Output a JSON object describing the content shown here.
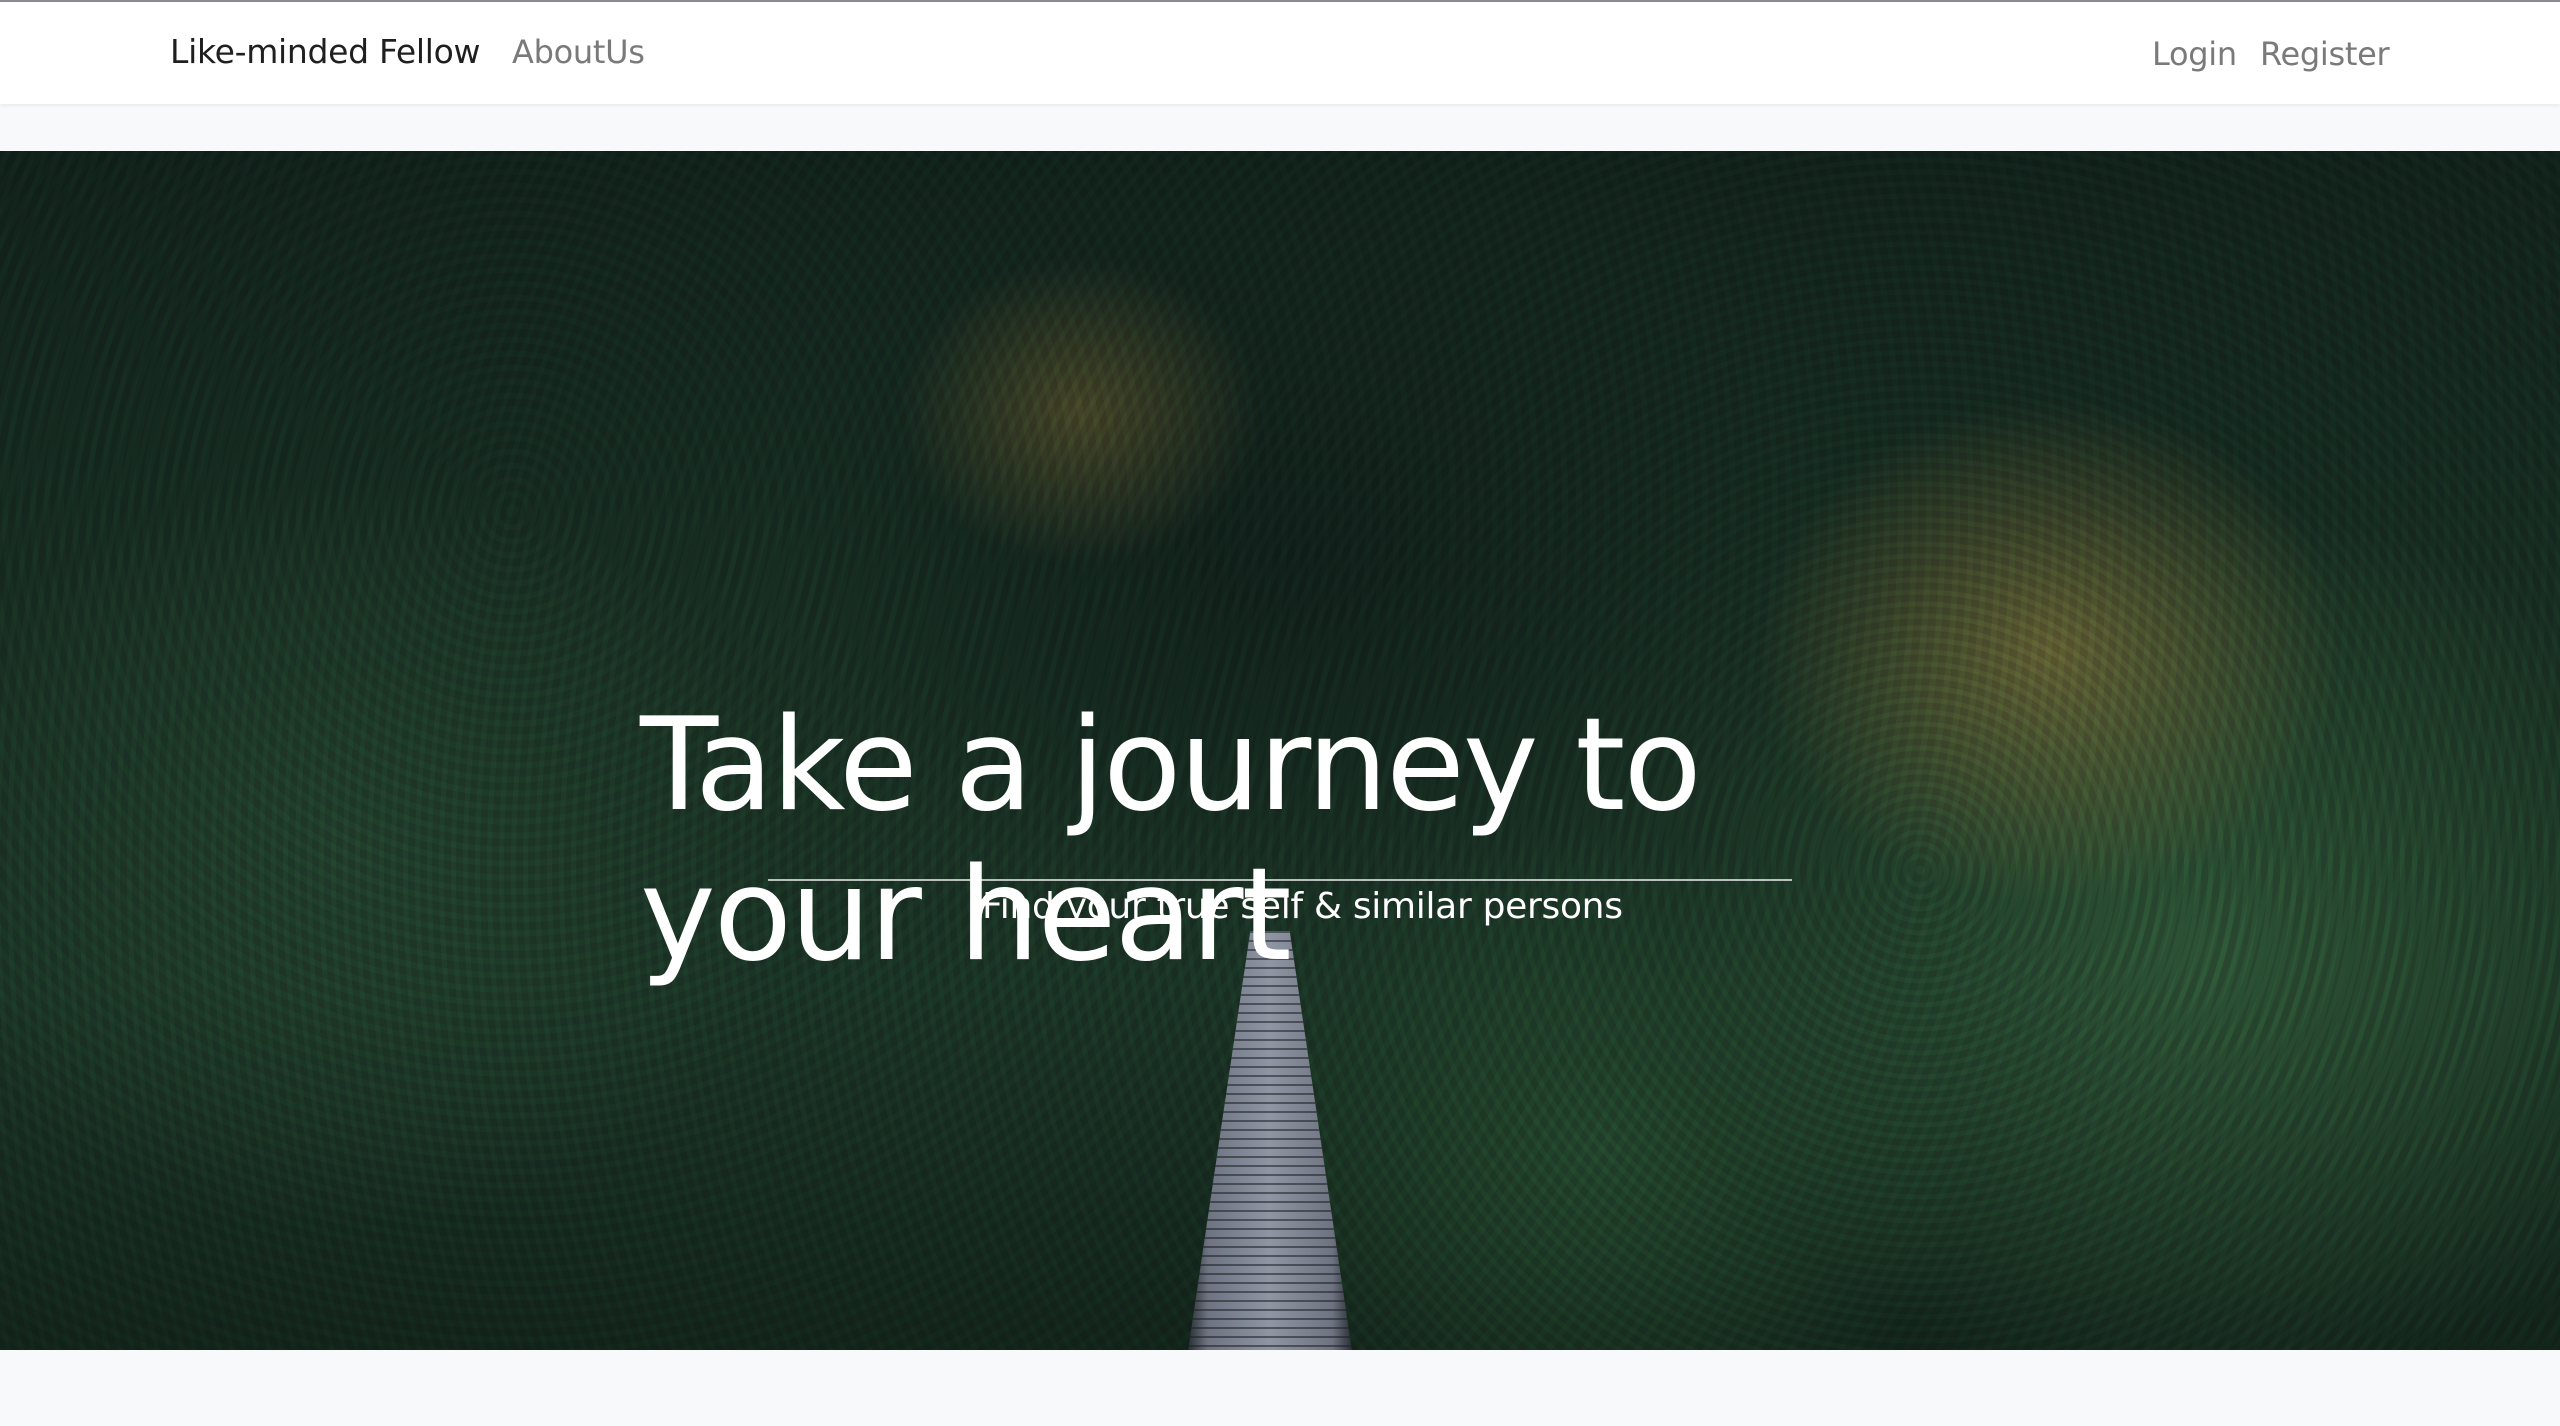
{
  "navbar": {
    "brand": "Like-minded Fellow",
    "links": {
      "about": "AboutUs",
      "login": "Login",
      "register": "Register"
    }
  },
  "hero": {
    "title_line1": "Take a journey to",
    "title_line2": "your heart",
    "subtitle": "Find your true self & similar persons"
  },
  "colors": {
    "page_background": "#f8f9fb",
    "navbar_background": "#ffffff",
    "brand_text": "#1f1f1f",
    "nav_link_text": "#7a7a7a",
    "hero_text": "#ffffff"
  }
}
